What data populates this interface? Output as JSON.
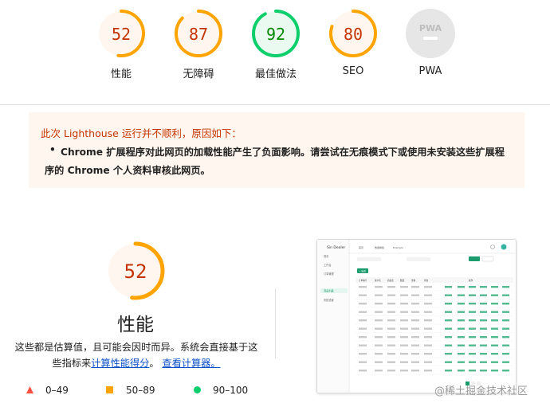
{
  "gauges": [
    {
      "score": "52",
      "label": "性能",
      "value": 52,
      "color": "#ffa400",
      "fill": "#fff7ef"
    },
    {
      "score": "87",
      "label": "无障碍",
      "value": 87,
      "color": "#ffa400",
      "fill": "#fff7ef"
    },
    {
      "score": "92",
      "label": "最佳做法",
      "value": 92,
      "color": "#0cce6b",
      "fill": "#eafaf0"
    },
    {
      "score": "80",
      "label": "SEO",
      "value": 80,
      "color": "#ffa400",
      "fill": "#fff7ef"
    },
    {
      "score": "PWA",
      "label": "PWA"
    }
  ],
  "warning": {
    "title": "此次 Lighthouse 运行并不顺利，原因如下：",
    "bullet_line1": "Chrome 扩展程序对此网页的加载性能产生了负面影响。请尝试在无痕模式下或使用未安装这些扩展程",
    "bullet_line2": "序的 Chrome 个人资料审核此网页。"
  },
  "performance": {
    "score": "52",
    "value": 52,
    "title": "性能",
    "desc_part1": "这些都是估算值，且可能会因时而异。系统会直接基于这",
    "desc_part2": "些指标来",
    "link1": "计算性能得分",
    "desc_part3": "。",
    "link2": "查看计算器。"
  },
  "legend": [
    {
      "range": "0–49",
      "shape": "triangle",
      "color": "#ff4e42"
    },
    {
      "range": "50–89",
      "shape": "square",
      "color": "#ffa400"
    },
    {
      "range": "90–100",
      "shape": "circle",
      "color": "#0cce6b"
    }
  ],
  "screenshot": {
    "app_name": "Sin Dealer",
    "sidebar": [
      "首页",
      "工作台",
      "订单管理",
      "商品列表",
      "系统设置"
    ],
    "tabs": [
      "首页",
      "数据看板",
      "Example"
    ],
    "button": "+ 新增",
    "headers": [
      "订单编号",
      "客户名",
      "商品名",
      "数量",
      "金额",
      "状态",
      "操作"
    ]
  },
  "watermark": "@稀土掘金技术社区"
}
